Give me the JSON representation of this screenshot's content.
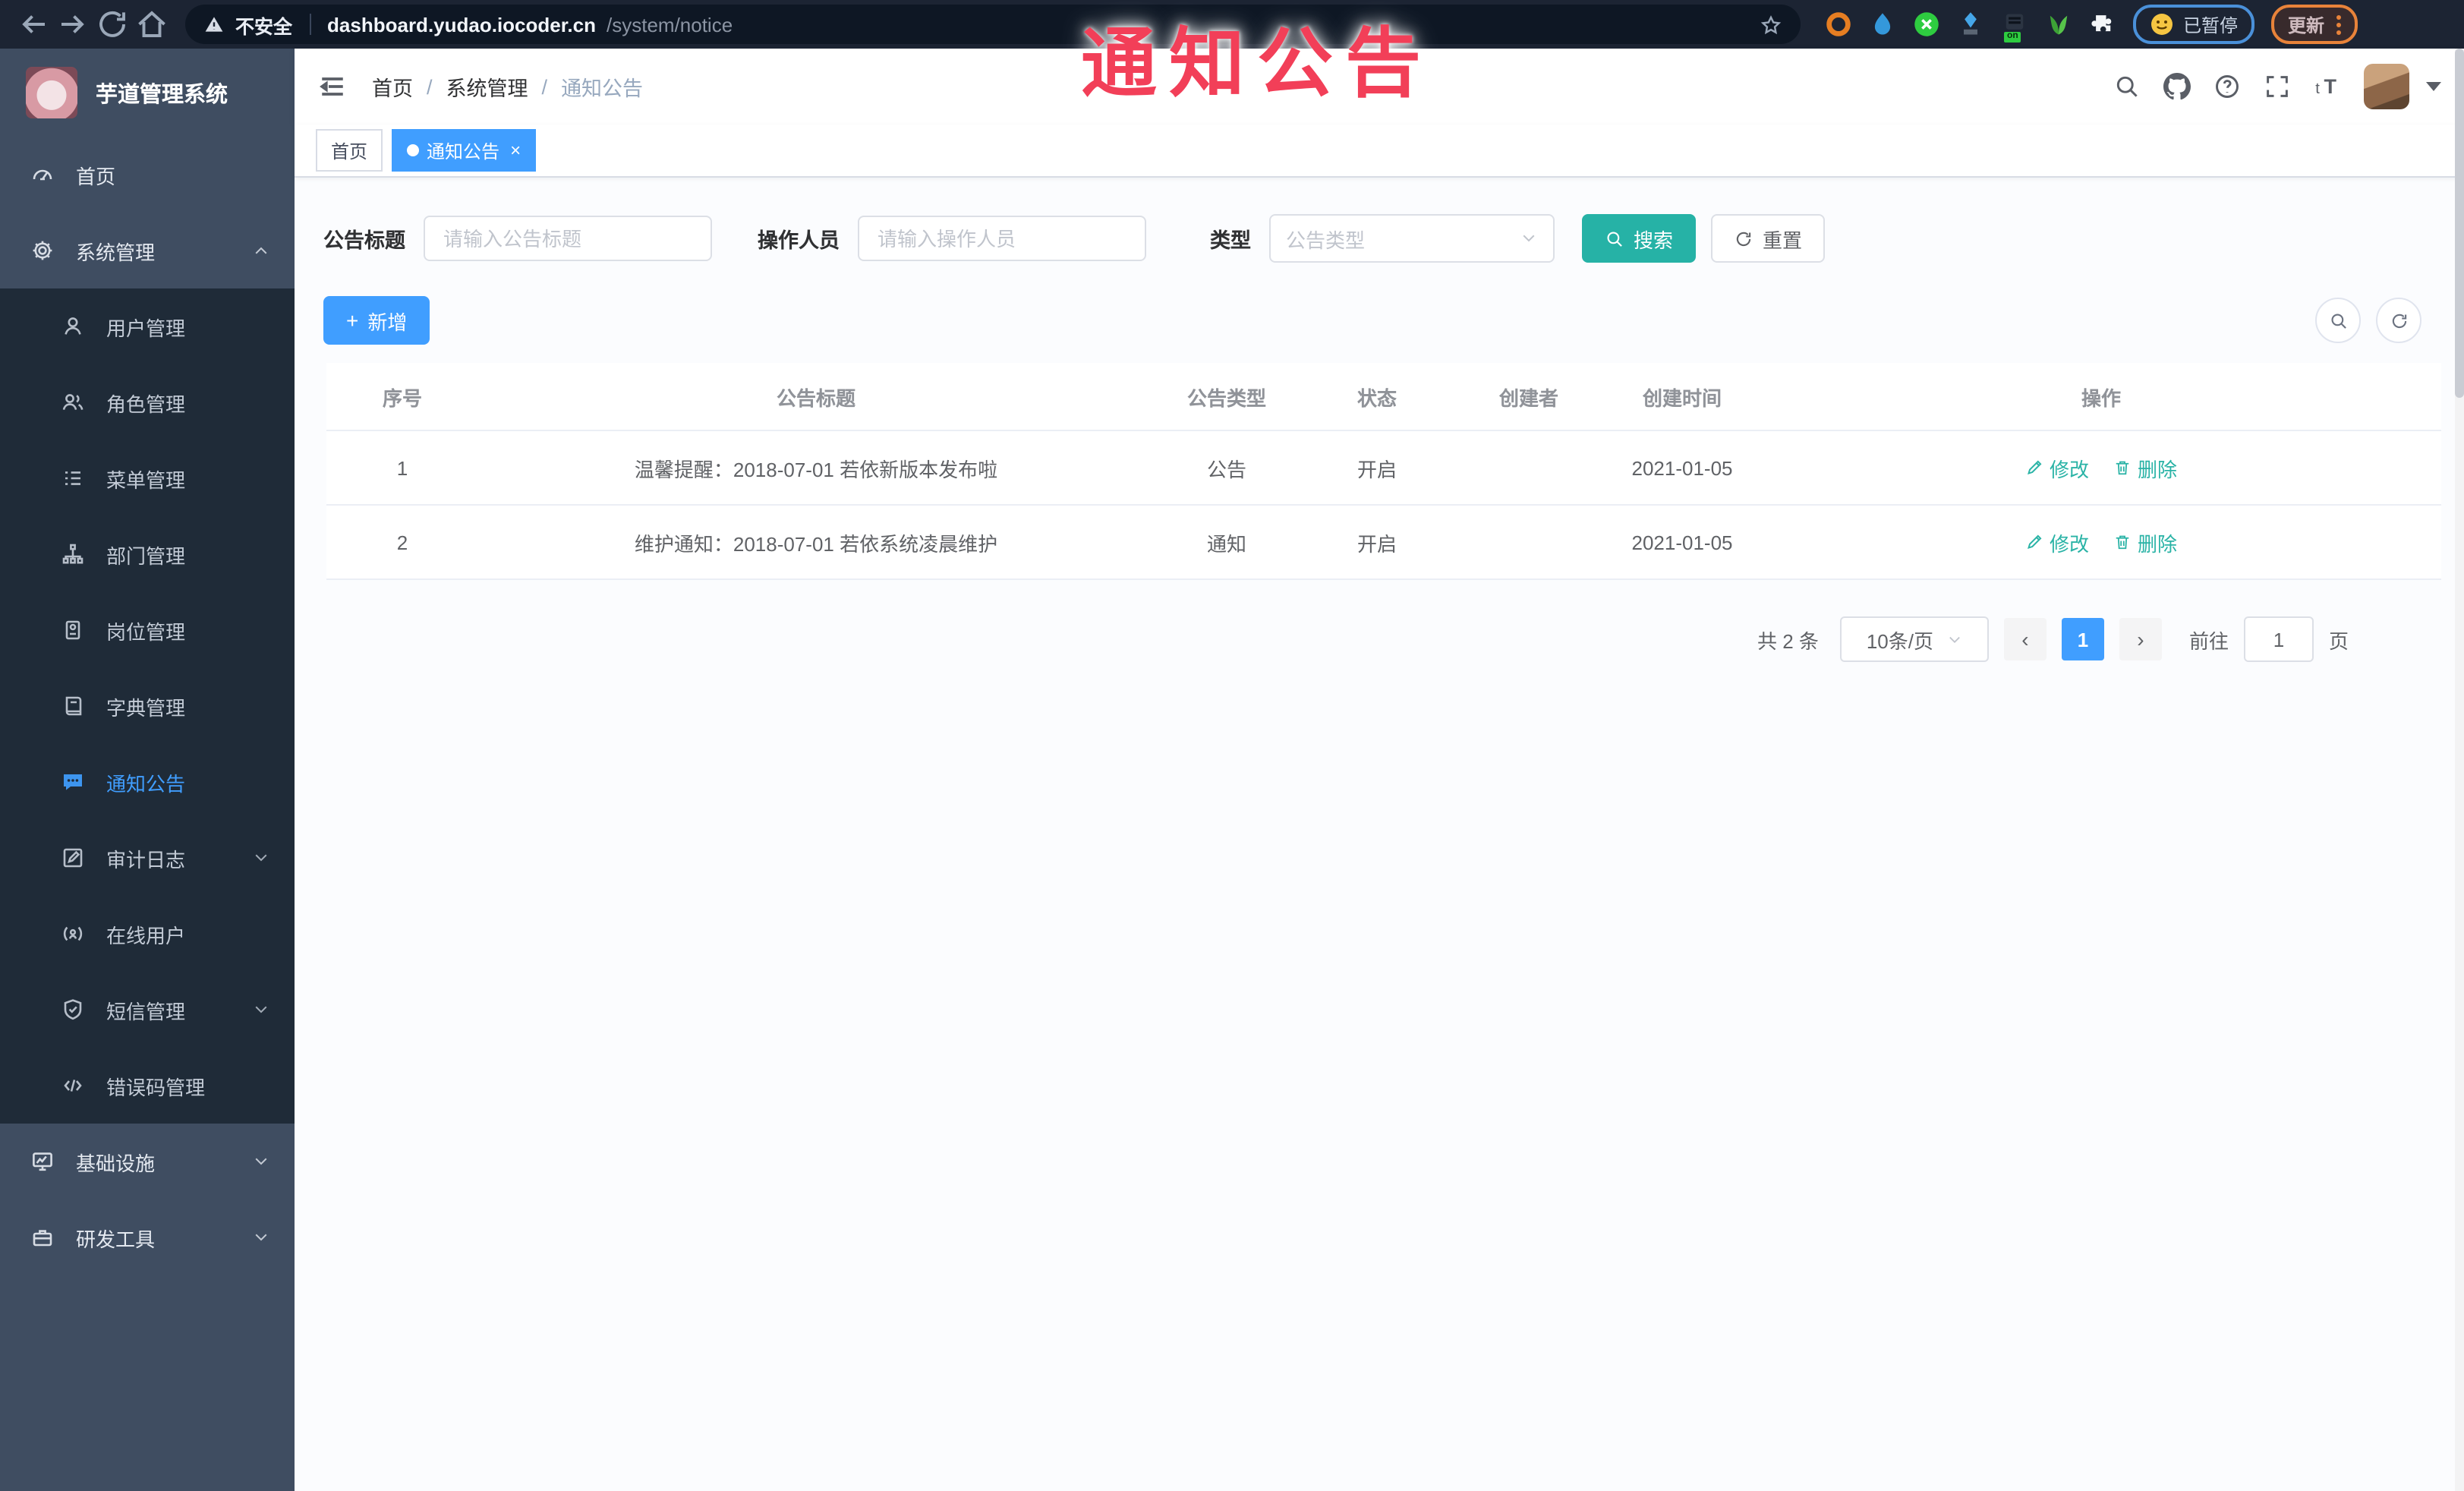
{
  "overlay": {
    "title": "通知公告",
    "color": "#f23f58"
  },
  "browser": {
    "security_label": "不安全",
    "url_host": "dashboard.yudao.iocoder.cn",
    "url_path": "/system/notice",
    "paused_label": "已暂停",
    "update_label": "更新"
  },
  "sidebar": {
    "logo_title": "芋道管理系统",
    "menu": [
      {
        "name": "home",
        "label": "首页",
        "icon": "dashboard-icon",
        "level": "top",
        "active": false,
        "arrow": ""
      },
      {
        "name": "system-management",
        "label": "系统管理",
        "icon": "gear-icon",
        "level": "top",
        "active": false,
        "arrow": "up"
      },
      {
        "name": "user-management",
        "label": "用户管理",
        "icon": "user-icon",
        "level": "sub",
        "active": false,
        "arrow": ""
      },
      {
        "name": "role-management",
        "label": "角色管理",
        "icon": "users-icon",
        "level": "sub",
        "active": false,
        "arrow": ""
      },
      {
        "name": "menu-management",
        "label": "菜单管理",
        "icon": "menu-list-icon",
        "level": "sub",
        "active": false,
        "arrow": ""
      },
      {
        "name": "department-management",
        "label": "部门管理",
        "icon": "org-tree-icon",
        "level": "sub",
        "active": false,
        "arrow": ""
      },
      {
        "name": "post-management",
        "label": "岗位管理",
        "icon": "badge-icon",
        "level": "sub",
        "active": false,
        "arrow": ""
      },
      {
        "name": "dict-management",
        "label": "字典管理",
        "icon": "dictionary-icon",
        "level": "sub",
        "active": false,
        "arrow": ""
      },
      {
        "name": "notice-announcement",
        "label": "通知公告",
        "icon": "announcement-icon",
        "level": "sub",
        "active": true,
        "arrow": ""
      },
      {
        "name": "audit-log",
        "label": "审计日志",
        "icon": "audit-log-icon",
        "level": "sub",
        "active": false,
        "arrow": "down"
      },
      {
        "name": "online-users",
        "label": "在线用户",
        "icon": "online-user-icon",
        "level": "sub",
        "active": false,
        "arrow": ""
      },
      {
        "name": "sms-management",
        "label": "短信管理",
        "icon": "sms-shield-icon",
        "level": "sub",
        "active": false,
        "arrow": "down"
      },
      {
        "name": "error-code-management",
        "label": "错误码管理",
        "icon": "error-code-icon",
        "level": "sub",
        "active": false,
        "arrow": ""
      },
      {
        "name": "infrastructure",
        "label": "基础设施",
        "icon": "infrastructure-icon",
        "level": "top",
        "active": false,
        "arrow": "down"
      },
      {
        "name": "dev-tools",
        "label": "研发工具",
        "icon": "dev-tools-icon",
        "level": "top",
        "active": false,
        "arrow": "down"
      }
    ]
  },
  "header": {
    "breadcrumb": [
      "首页",
      "系统管理",
      "通知公告"
    ]
  },
  "tags": [
    {
      "label": "首页",
      "active": false
    },
    {
      "label": "通知公告",
      "active": true
    }
  ],
  "filters": {
    "title_label": "公告标题",
    "title_placeholder": "请输入公告标题",
    "operator_label": "操作人员",
    "operator_placeholder": "请输入操作人员",
    "type_label": "类型",
    "type_placeholder": "公告类型",
    "search_label": "搜索",
    "reset_label": "重置"
  },
  "toolbar": {
    "add_label": "新增"
  },
  "table": {
    "columns": [
      "序号",
      "公告标题",
      "公告类型",
      "状态",
      "创建者",
      "创建时间",
      "操作"
    ],
    "rows": [
      {
        "no": "1",
        "title": "温馨提醒：2018-07-01 若依新版本发布啦",
        "type": "公告",
        "status": "开启",
        "creator": "",
        "created": "2021-01-05"
      },
      {
        "no": "2",
        "title": "维护通知：2018-07-01 若依系统凌晨维护",
        "type": "通知",
        "status": "开启",
        "creator": "",
        "created": "2021-01-05"
      }
    ],
    "edit_label": "修改",
    "delete_label": "删除"
  },
  "pagination": {
    "total_label": "共 2 条",
    "page_size": "10条/页",
    "current_page": "1",
    "goto_label": "前往",
    "goto_value": "1",
    "page_label": "页"
  },
  "colors": {
    "primary": "#409eff",
    "search_button": "#26b2a6",
    "action_link": "#2ab3a6",
    "sidebar_bg": "#3f4d61",
    "submenu_bg": "#1f2b38",
    "browser_bar_bg": "#1c2433",
    "overlay_text": "#f23f58"
  }
}
